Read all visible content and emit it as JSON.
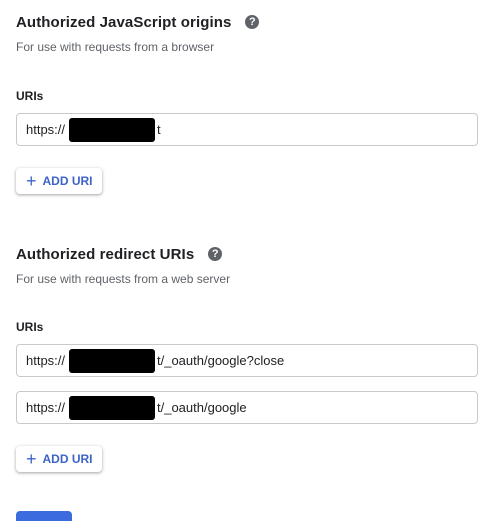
{
  "js_origins": {
    "title": "Authorized JavaScript origins",
    "help_icon": "?",
    "subtitle": "For use with requests from a browser",
    "uris_label": "URIs",
    "uris": [
      {
        "prefix": "https://",
        "suffix": "t"
      }
    ],
    "add_button": "ADD URI"
  },
  "redirect": {
    "title": "Authorized redirect URIs",
    "help_icon": "?",
    "subtitle": "For use with requests from a web server",
    "uris_label": "URIs",
    "uris": [
      {
        "prefix": "https://",
        "suffix": "t/_oauth/google?close"
      },
      {
        "prefix": "https://",
        "suffix": "t/_oauth/google"
      }
    ],
    "add_button": "ADD URI"
  },
  "icons": {
    "add": "plus-icon",
    "help": "help-circle-icon"
  },
  "colors": {
    "accent": "#3c64c8",
    "redaction": "#000000"
  }
}
